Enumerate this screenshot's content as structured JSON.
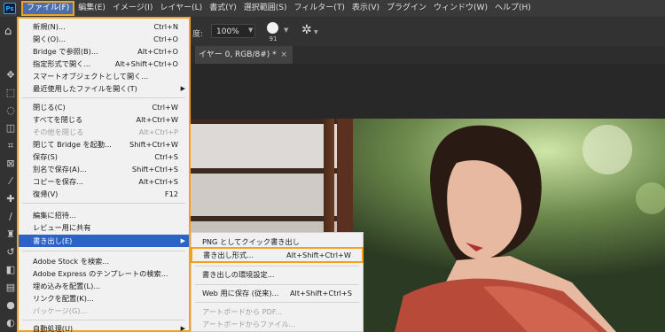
{
  "menubar": {
    "logo": "Ps",
    "items": [
      {
        "label": "ファイル(F)"
      },
      {
        "label": "編集(E)"
      },
      {
        "label": "イメージ(I)"
      },
      {
        "label": "レイヤー(L)"
      },
      {
        "label": "書式(Y)"
      },
      {
        "label": "選択範囲(S)"
      },
      {
        "label": "フィルター(T)"
      },
      {
        "label": "表示(V)"
      },
      {
        "label": "プラグイン"
      },
      {
        "label": "ウィンドウ(W)"
      },
      {
        "label": "ヘルプ(H)"
      }
    ]
  },
  "options": {
    "label": "度:",
    "value": "100%",
    "brush_size": "91"
  },
  "document_tab": {
    "title": "イヤー 0, RGB/8#) *",
    "close": "×"
  },
  "file_menu": {
    "items": [
      {
        "label": "新規(N)...",
        "shortcut": "Ctrl+N"
      },
      {
        "label": "開く(O)...",
        "shortcut": "Ctrl+O"
      },
      {
        "label": "Bridge で参照(B)...",
        "shortcut": "Alt+Ctrl+O"
      },
      {
        "label": "指定形式で開く...",
        "shortcut": "Alt+Shift+Ctrl+O"
      },
      {
        "label": "スマートオブジェクトとして開く...",
        "shortcut": ""
      },
      {
        "label": "最近使用したファイルを開く(T)",
        "shortcut": ""
      },
      {
        "label": "閉じる(C)",
        "shortcut": "Ctrl+W"
      },
      {
        "label": "すべてを閉じる",
        "shortcut": "Alt+Ctrl+W"
      },
      {
        "label": "その他を閉じる",
        "shortcut": "Alt+Ctrl+P"
      },
      {
        "label": "閉じて Bridge を起動...",
        "shortcut": "Shift+Ctrl+W"
      },
      {
        "label": "保存(S)",
        "shortcut": "Ctrl+S"
      },
      {
        "label": "別名で保存(A)...",
        "shortcut": "Shift+Ctrl+S"
      },
      {
        "label": "コピーを保存...",
        "shortcut": "Alt+Ctrl+S"
      },
      {
        "label": "復帰(V)",
        "shortcut": "F12"
      },
      {
        "label": "編集に招待...",
        "shortcut": ""
      },
      {
        "label": "レビュー用に共有",
        "shortcut": ""
      },
      {
        "label": "書き出し(E)",
        "shortcut": ""
      },
      {
        "label": "Adobe Stock を検索...",
        "shortcut": ""
      },
      {
        "label": "Adobe Express のテンプレートの検索...",
        "shortcut": ""
      },
      {
        "label": "埋め込みを配置(L)...",
        "shortcut": ""
      },
      {
        "label": "リンクを配置(K)...",
        "shortcut": ""
      },
      {
        "label": "パッケージ(G)...",
        "shortcut": ""
      },
      {
        "label": "自動処理(U)",
        "shortcut": ""
      }
    ]
  },
  "export_submenu": {
    "items": [
      {
        "label": "PNG としてクイック書き出し",
        "shortcut": ""
      },
      {
        "label": "書き出し形式...",
        "shortcut": "Alt+Shift+Ctrl+W"
      },
      {
        "label": "書き出しの環境設定...",
        "shortcut": ""
      },
      {
        "label": "Web 用に保存 (従来)...",
        "shortcut": "Alt+Shift+Ctrl+S"
      },
      {
        "label": "アートボードから PDF...",
        "shortcut": ""
      },
      {
        "label": "アートボードからファイル...",
        "shortcut": ""
      }
    ]
  },
  "colors": {
    "highlight": "#2b63c9",
    "callout": "#f4a21d",
    "menubar": "#3a3a3a"
  }
}
